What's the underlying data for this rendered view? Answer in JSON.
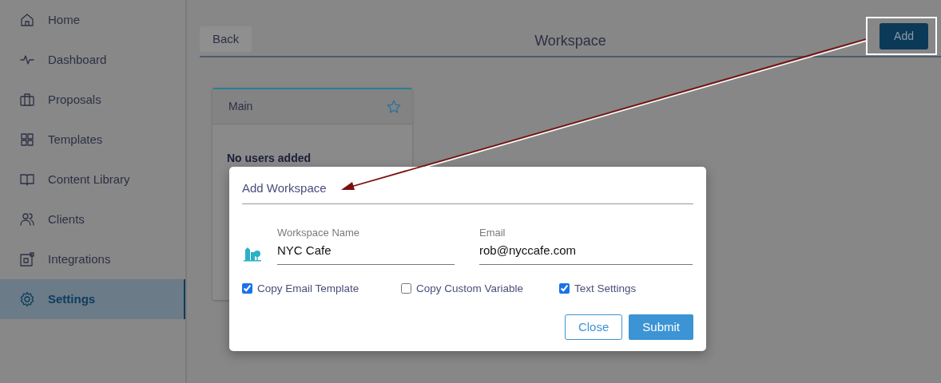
{
  "sidebar": {
    "items": [
      {
        "label": "Home",
        "selected": false
      },
      {
        "label": "Dashboard",
        "selected": false
      },
      {
        "label": "Proposals",
        "selected": false
      },
      {
        "label": "Templates",
        "selected": false
      },
      {
        "label": "Content Library",
        "selected": false
      },
      {
        "label": "Clients",
        "selected": false
      },
      {
        "label": "Integrations",
        "selected": false
      },
      {
        "label": "Settings",
        "selected": true
      }
    ]
  },
  "header": {
    "back_button": "Back",
    "title": "Workspace",
    "add_button": "Add"
  },
  "card": {
    "title": "Main",
    "starred": false,
    "message": "No users added"
  },
  "modal": {
    "title": "Add Workspace",
    "fields": [
      {
        "label": "Workspace Name",
        "value": "NYC Cafe"
      },
      {
        "label": "Email",
        "value": "rob@nyccafe.com"
      }
    ],
    "checkboxes": [
      {
        "label": "Copy Email Template",
        "checked": true
      },
      {
        "label": "Copy Custom Variable",
        "checked": false
      },
      {
        "label": "Text Settings",
        "checked": true
      }
    ],
    "buttons": {
      "close": "Close",
      "submit": "Submit"
    }
  }
}
